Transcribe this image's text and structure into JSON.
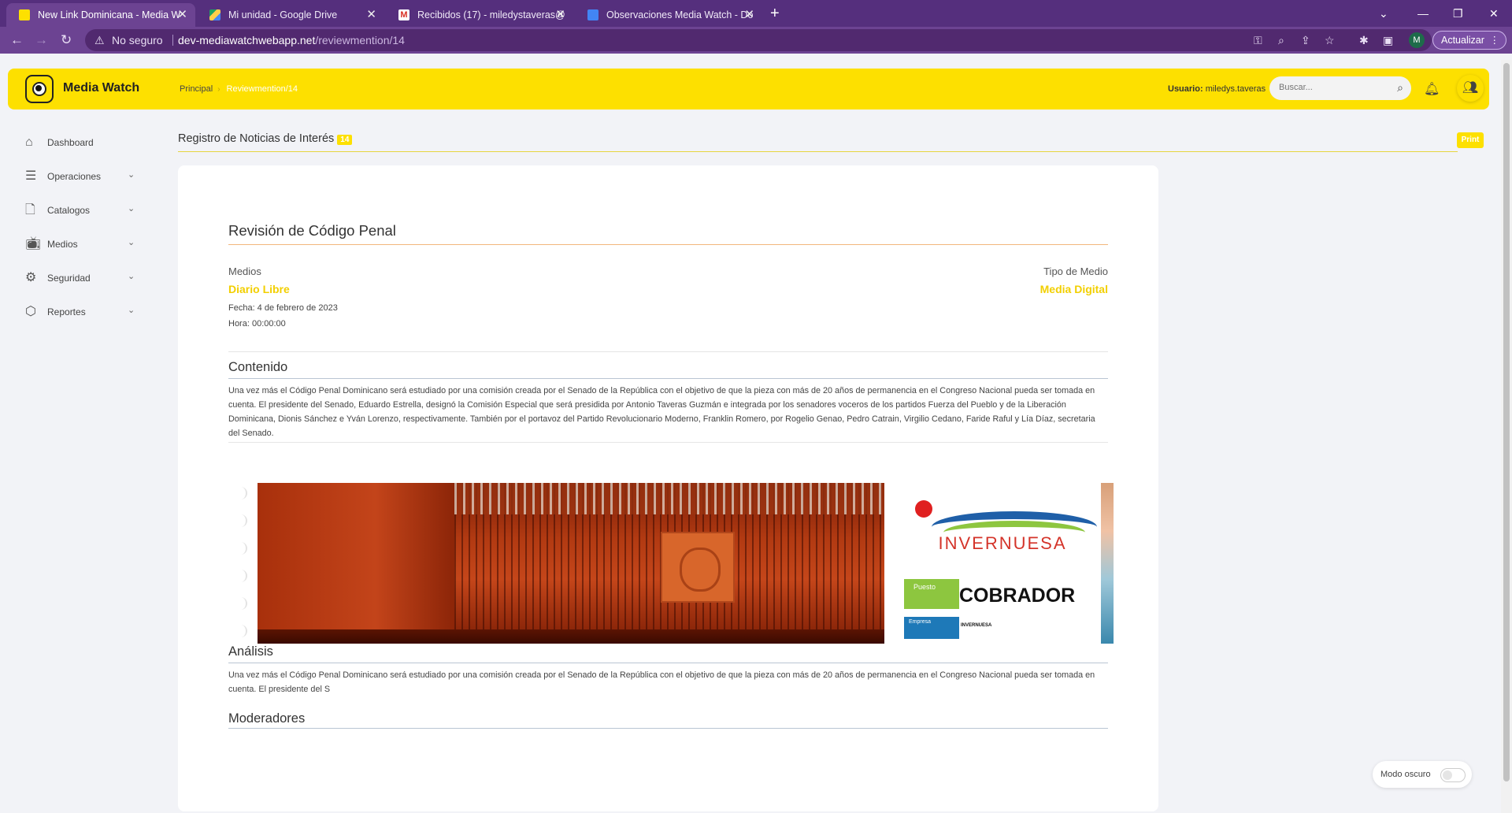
{
  "browser": {
    "tabs": [
      {
        "title": "New Link Dominicana - Media W",
        "active": true,
        "favicon": "media-watch-favicon"
      },
      {
        "title": "Mi unidad - Google Drive",
        "active": false,
        "favicon": "google-drive-favicon"
      },
      {
        "title": "Recibidos (17) - miledystaveras@",
        "active": false,
        "favicon": "gmail-favicon"
      },
      {
        "title": "Observaciones Media Watch - Do",
        "active": false,
        "favicon": "google-docs-favicon"
      }
    ],
    "security_label": "No seguro",
    "url_host": "dev-mediawatchwebapp.net",
    "url_path": "/reviewmention/14",
    "profile_initial": "M",
    "update_label": "Actualizar"
  },
  "header": {
    "app_name": "Media Watch",
    "breadcrumb": [
      "Principal",
      "Reviewmention/14"
    ],
    "user_label": "Usuario:",
    "user_name": "miledys.taveras",
    "search_placeholder": "Buscar..."
  },
  "sidebar": {
    "items": [
      {
        "label": "Dashboard",
        "icon": "home-icon",
        "has_chevron": false
      },
      {
        "label": "Operaciones",
        "icon": "database-icon",
        "has_chevron": true
      },
      {
        "label": "Catalogos",
        "icon": "file-plus-icon",
        "has_chevron": true
      },
      {
        "label": "Medios",
        "icon": "tv-icon",
        "has_chevron": true
      },
      {
        "label": "Seguridad",
        "icon": "gear-icon",
        "has_chevron": true
      },
      {
        "label": "Reportes",
        "icon": "box-icon",
        "has_chevron": true
      }
    ]
  },
  "page": {
    "title": "Registro de Noticias de Interés",
    "badge": "14",
    "print_label": "Print"
  },
  "review": {
    "title": "Revisión de Código Penal",
    "medios_label": "Medios",
    "medio": "Diario Libre",
    "fecha": "Fecha: 4 de febrero de 2023",
    "hora": "Hora: 00:00:00",
    "tipo_label": "Tipo de Medio",
    "tipo": "Media Digital",
    "contenido_title": "Contenido",
    "contenido": "Una vez más el Código Penal Dominicano será estudiado por una comisión creada por el Senado de la República con el objetivo de que la pieza con más de 20 años de permanencia en el Congreso Nacional pueda ser tomada en cuenta. El presidente del Senado, Eduardo Estrella, designó la Comisión Especial que será presidida por Antonio Taveras Guzmán e integrada por los senadores voceros de los partidos Fuerza del Pueblo y de la Liberación Dominicana, Dionis Sánchez e Yván Lorenzo, respectivamente. También por el portavoz del Partido Revolucionario Moderno, Franklin Romero, por Rogelio Genao, Pedro Catrain, Virgilio Cedano, Faride Raful y Lía Díaz, secretaria del Senado.",
    "analisis_title": "Análisis",
    "analisis": "Una vez más el Código Penal Dominicano será estudiado por una comisión creada por el Senado de la República con el objetivo de que la pieza con más de 20 años de permanencia en el Congreso Nacional pueda ser tomada en cuenta. El presidente del S",
    "moderadores_title": "Moderadores",
    "gallery": {
      "job_image": {
        "brand": "INVERNUESA",
        "puesto_label": "Puesto",
        "puesto": "COBRADOR",
        "empresa_label": "Empresa",
        "empresa": "INVERNUESA"
      }
    }
  },
  "dark_mode": {
    "label": "Modo oscuro",
    "enabled": false
  },
  "colors": {
    "accent": "#fde000",
    "browser": "#6c4392"
  }
}
